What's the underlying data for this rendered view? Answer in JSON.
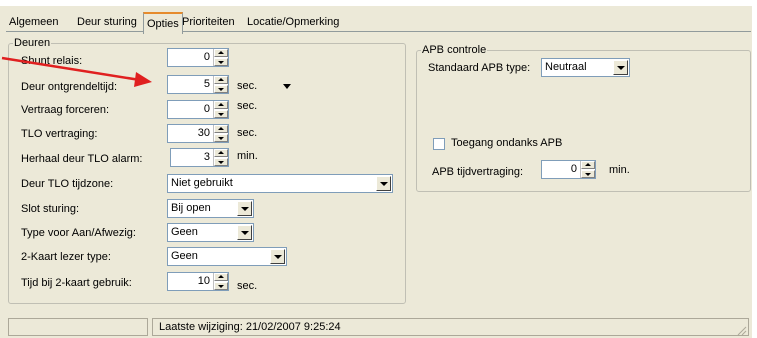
{
  "tabs": [
    {
      "label": "Algemeen"
    },
    {
      "label": "Deur sturing"
    },
    {
      "label": "Opties"
    },
    {
      "label": "Prioriteiten"
    },
    {
      "label": "Locatie/Opmerking"
    }
  ],
  "active_tab": "Opties",
  "deuren": {
    "legend": "Deuren",
    "shunt_relais": {
      "label": "Shunt relais:",
      "value": "0"
    },
    "deur_ontgrendeltijd": {
      "label": "Deur ontgrendeltijd:",
      "value": "5",
      "unit": "sec."
    },
    "vertraag_forceren": {
      "label": "Vertraag forceren:",
      "value": "0",
      "unit": "sec."
    },
    "tlo_vertraging": {
      "label": "TLO vertraging:",
      "value": "30",
      "unit": "sec."
    },
    "herhaal_tlo_alarm": {
      "label": "Herhaal deur TLO alarm:",
      "value": "3",
      "unit": "min."
    },
    "tlo_tijdzone": {
      "label": "Deur TLO tijdzone:",
      "value": "Niet gebruikt"
    },
    "slot_sturing": {
      "label": "Slot sturing:",
      "value": "Bij open"
    },
    "type_aanafwezig": {
      "label": "Type voor Aan/Afwezig:",
      "value": "Geen"
    },
    "kaartlezer_type": {
      "label": "2-Kaart lezer type:",
      "value": "Geen"
    },
    "tijd_2kaart": {
      "label": "Tijd bij 2-kaart gebruik:",
      "value": "10",
      "unit": "sec."
    }
  },
  "apb": {
    "legend": "APB controle",
    "standaard_type": {
      "label": "Standaard APB type:",
      "value": "Neutraal"
    },
    "toegang_ondanks": {
      "label": "Toegang ondanks APB",
      "checked": false
    },
    "tijdvertraging": {
      "label": "APB tijdvertraging:",
      "value": "0",
      "unit": "min."
    }
  },
  "status": {
    "text": "Laatste wijziging: 21/02/2007 9:25:24"
  },
  "colors": {
    "dialog_bg": "#ece9d8",
    "active_tab_accent": "#e68b2c",
    "annotation_arrow": "#e02020"
  }
}
